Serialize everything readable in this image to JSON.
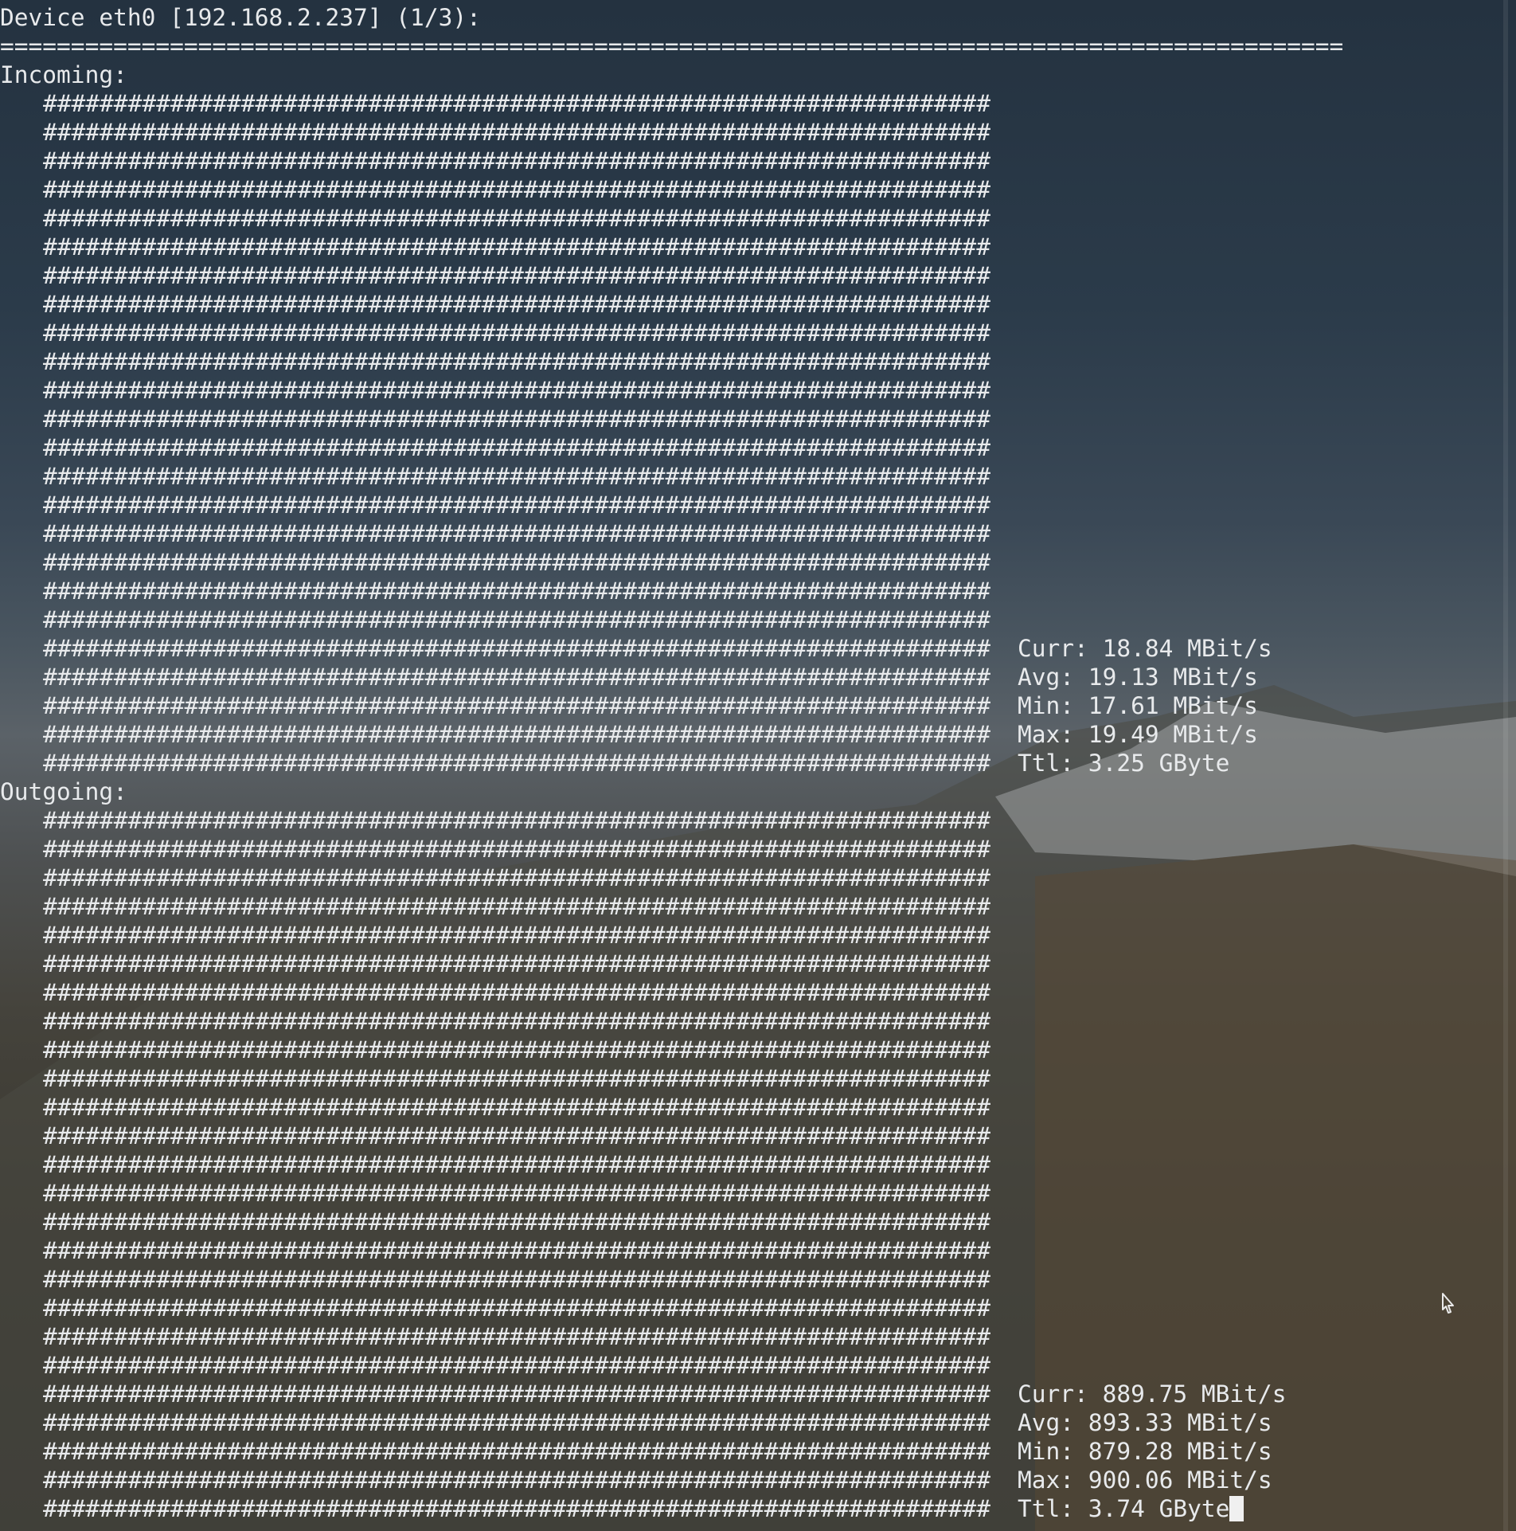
{
  "terminal": {
    "header": "Device eth0 [192.168.2.237] (1/3):",
    "separator": "===============================================================================================",
    "incoming": {
      "label": "Incoming:",
      "bar_text": "###################################################################",
      "curr": "Curr: 18.84 MBit/s",
      "avg": "Avg: 19.13 MBit/s",
      "min": "Min: 17.61 MBit/s",
      "max": "Max: 19.49 MBit/s",
      "ttl": "Ttl: 3.25 GByte"
    },
    "outgoing": {
      "label": "Outgoing:",
      "bar_text": "###################################################################",
      "curr": "Curr: 889.75 MBit/s",
      "avg": "Avg: 893.33 MBit/s",
      "min": "Min: 879.28 MBit/s",
      "max": "Max: 900.06 MBit/s",
      "ttl": "Ttl: 3.74 GByte"
    }
  },
  "colors": {
    "text": "#e8eaec",
    "cursor": "#f0f0f0"
  }
}
